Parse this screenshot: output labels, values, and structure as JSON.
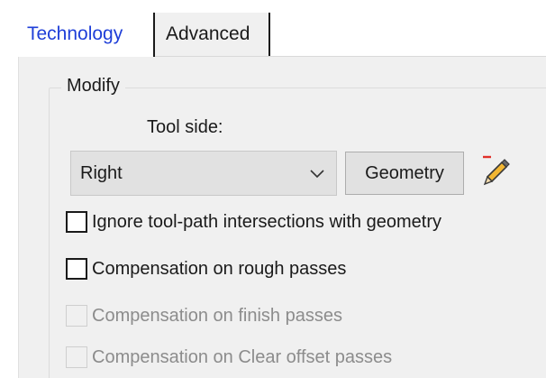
{
  "tabs": {
    "technology": "Technology",
    "advanced": "Advanced"
  },
  "modify_group": {
    "title": "Modify",
    "tool_side_label": "Tool side:",
    "tool_side_value": "Right",
    "geometry_button": "Geometry",
    "edit_icon": "pencil-icon"
  },
  "options": [
    {
      "label": "Ignore tool-path intersections with geometry",
      "checked": false,
      "enabled": true
    },
    {
      "label": "Compensation on rough passes",
      "checked": false,
      "enabled": true
    },
    {
      "label": "Compensation on finish passes",
      "checked": false,
      "enabled": false
    },
    {
      "label": "Compensation on Clear offset passes",
      "checked": false,
      "enabled": false
    }
  ],
  "colors": {
    "active_tab_text": "#1f3fd8",
    "panel_bg": "#f0f0f0",
    "disabled_text": "#8c8c8c"
  }
}
